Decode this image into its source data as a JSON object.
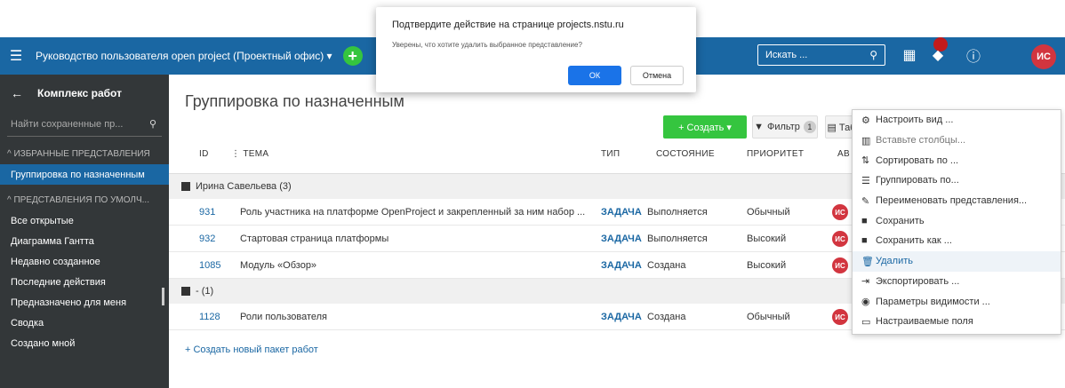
{
  "header": {
    "project": "Руководство пользователя open project (Проектный офис) ▾",
    "search_placeholder": "Искать ...",
    "avatar": "ИС"
  },
  "sidebar": {
    "title": "Комплекс работ",
    "search_placeholder": "Найти сохраненные пр...",
    "section_favorites": "ИЗБРАННЫЕ ПРЕДСТАВЛЕНИЯ",
    "favorite_item": "Группировка по назначенным",
    "section_default": "ПРЕДСТАВЛЕНИЯ ПО УМОЛЧ...",
    "items": [
      "Все открытые",
      "Диаграмма Гантта",
      "Недавно созданное",
      "Последние действия",
      "Предназначено для меня",
      "Сводка",
      "Создано мной"
    ]
  },
  "main": {
    "title": "Группировка по назначенным",
    "create_label": "+ Создать ▾",
    "filter_label": "Фильтр",
    "filter_count": "1",
    "table_label": "Таблица ▾",
    "columns": {
      "id": "ID",
      "subject": "ТЕМА",
      "type": "ТИП",
      "status": "СОСТОЯНИЕ",
      "priority": "ПРИОРИТЕТ",
      "assignee": "АВ"
    },
    "group1": "Ирина Савельева (3)",
    "group2": "- (1)",
    "rows": [
      {
        "id": "931",
        "subject": "Роль участника на платформе OpenProject и закрепленный за ним набор ...",
        "type": "ЗАДАЧА",
        "status": "Выполняется",
        "priority": "Обычный",
        "avatar": "ИС"
      },
      {
        "id": "932",
        "subject": "Стартовая страница платформы",
        "type": "ЗАДАЧА",
        "status": "Выполняется",
        "priority": "Высокий",
        "avatar": "ИС"
      },
      {
        "id": "1085",
        "subject": "Модуль «Обзор»",
        "type": "ЗАДАЧА",
        "status": "Создана",
        "priority": "Высокий",
        "avatar": "ИС"
      },
      {
        "id": "1128",
        "subject": "Роли пользователя",
        "type": "ЗАДАЧА",
        "status": "Создана",
        "priority": "Обычный",
        "avatar": "ИС"
      }
    ],
    "create_link": "+ Создать новый пакет работ"
  },
  "dropdown": {
    "items": [
      {
        "icon": "⚙",
        "label": "Настроить вид ..."
      },
      {
        "icon": "▥",
        "label": "Вставьте столбцы..."
      },
      {
        "icon": "⇅",
        "label": "Сортировать по ..."
      },
      {
        "icon": "☰",
        "label": "Группировать по..."
      },
      {
        "icon": "✎",
        "label": "Переименовать представления..."
      },
      {
        "icon": "■",
        "label": "Сохранить"
      },
      {
        "icon": "■",
        "label": "Сохранить как ..."
      },
      {
        "icon": "🗑",
        "label": "Удалить"
      },
      {
        "icon": "⇥",
        "label": "Экспортировать ..."
      },
      {
        "icon": "◉",
        "label": "Параметры видимости ..."
      },
      {
        "icon": "▭",
        "label": "Настраиваемые поля"
      }
    ]
  },
  "dialog": {
    "title": "Подтвердите действие на странице projects.nstu.ru",
    "message": "Уверены, что хотите удалить выбранное представление?",
    "ok": "ОК",
    "cancel": "Отмена"
  },
  "colors": {
    "header": "#1a67a3",
    "sidebar": "#333739",
    "accent": "#35c53f",
    "avatar": "#d2353f"
  }
}
